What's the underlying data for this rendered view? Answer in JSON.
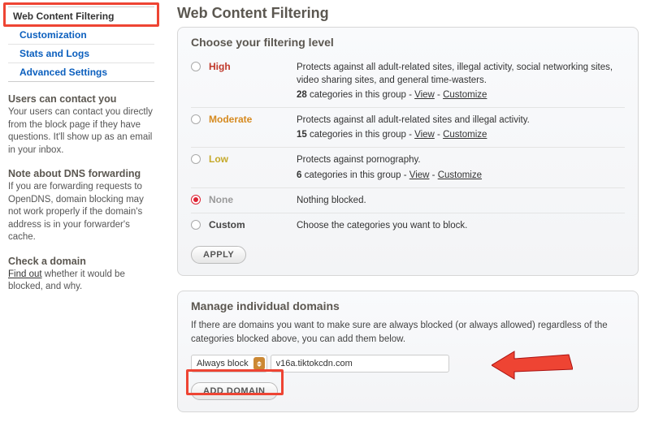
{
  "sidebar": {
    "nav": [
      {
        "label": "Web Content Filtering",
        "active": true
      },
      {
        "label": "Customization"
      },
      {
        "label": "Stats and Logs"
      },
      {
        "label": "Advanced Settings"
      }
    ],
    "contact": {
      "title": "Users can contact you",
      "body": "Your users can contact you directly from the block page if they have questions. It'll show up as an email in your inbox."
    },
    "dns": {
      "title": "Note about DNS forwarding",
      "body": "If you are forwarding requests to OpenDNS, domain blocking may not work properly if the domain's address is in your forwarder's cache."
    },
    "check": {
      "title": "Check a domain",
      "link": "Find out",
      "rest": " whether it would be blocked, and why."
    }
  },
  "main": {
    "title": "Web Content Filtering",
    "filter": {
      "heading": "Choose your filtering level",
      "view": "View",
      "customize": "Customize",
      "apply": "APPLY",
      "levels": [
        {
          "name": "High",
          "cls": "level-high",
          "desc": "Protects against all adult-related sites, illegal activity, social networking sites, video sharing sites, and general time-wasters.",
          "count": "28",
          "cat_text": " categories in this group - ",
          "selected": false
        },
        {
          "name": "Moderate",
          "cls": "level-moderate",
          "desc": "Protects against all adult-related sites and illegal activity.",
          "count": "15",
          "cat_text": " categories in this group - ",
          "selected": false
        },
        {
          "name": "Low",
          "cls": "level-low",
          "desc": "Protects against pornography.",
          "count": "6",
          "cat_text": " categories in this group - ",
          "selected": false
        },
        {
          "name": "None",
          "cls": "level-none",
          "desc": "Nothing blocked.",
          "selected": true
        },
        {
          "name": "Custom",
          "cls": "level-custom",
          "desc": "Choose the categories you want to block.",
          "selected": false
        }
      ]
    },
    "domains": {
      "heading": "Manage individual domains",
      "intro": "If there are domains you want to make sure are always blocked (or always allowed) regardless of the categories blocked above, you can add them below.",
      "select_label": "Always block",
      "input_value": "v16a.tiktokcdn.com",
      "add_button": "ADD DOMAIN"
    }
  }
}
